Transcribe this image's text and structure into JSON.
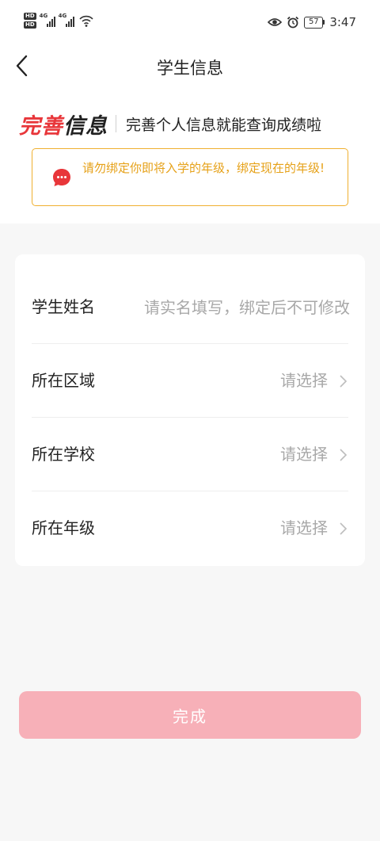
{
  "status_bar": {
    "hd_label": "HD",
    "network_label": "4G",
    "time": "3:47",
    "battery": "57"
  },
  "nav": {
    "title": "学生信息"
  },
  "headline": {
    "strong_red": "完善",
    "strong_dark": "信息",
    "subtitle": "完善个人信息就能查询成绩啦"
  },
  "notice": {
    "text": "请勿绑定你即将入学的年级，绑定现在的年级!"
  },
  "form": {
    "name": {
      "label": "学生姓名",
      "placeholder": "请实名填写，绑定后不可修改",
      "value": ""
    },
    "region": {
      "label": "所在区域",
      "value": "请选择"
    },
    "school": {
      "label": "所在学校",
      "value": "请选择"
    },
    "grade": {
      "label": "所在年级",
      "value": "请选择"
    }
  },
  "submit": {
    "label": "完成"
  },
  "colors": {
    "accent_red": "#e8363a",
    "notice_orange": "#e6a118",
    "notice_border": "#f0b030",
    "button_pink": "#f7b0b8"
  }
}
